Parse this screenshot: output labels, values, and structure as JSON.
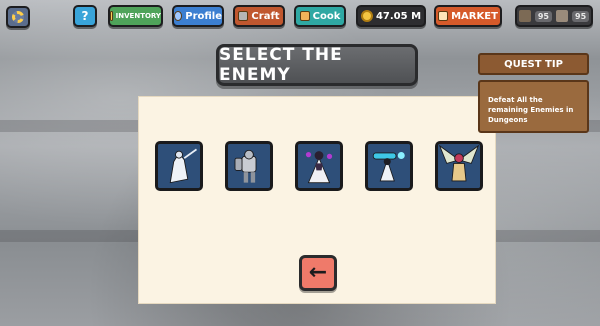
{
  "topbar": {
    "settings_icon": "gear-icon",
    "help_label": "?",
    "inventory_label": "INVENTORY",
    "profile_label": "Profile",
    "craft_label": "Craft",
    "cook_label": "Cook",
    "gold_amount": "47.05 M",
    "market_label": "MARKET",
    "resource_a_value": "95",
    "resource_b_value": "95"
  },
  "dialog": {
    "title": "SELECT THE ENEMY",
    "back_icon": "arrow-left-icon",
    "enemies": [
      {
        "icon": "white-swordsman-icon"
      },
      {
        "icon": "armored-knight-icon"
      },
      {
        "icon": "dark-witch-icon"
      },
      {
        "icon": "cannon-gunner-icon"
      },
      {
        "icon": "winged-beast-icon"
      }
    ]
  },
  "quest": {
    "header": "QUEST TIP",
    "body": "Defeat All the remaining Enemies in Dungeons"
  },
  "colors": {
    "panel_bg": "#fbf3e3",
    "tile_bg": "#2e4f79",
    "back_button": "#ef7a6a",
    "quest_brown": "#9a6a3e",
    "market_orange": "#d65a2a"
  }
}
